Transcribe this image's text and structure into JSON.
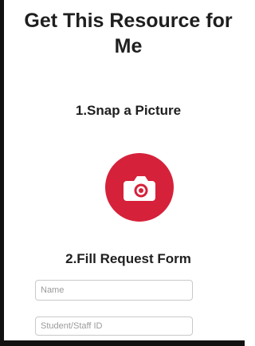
{
  "page": {
    "title": "Get This Resource for Me"
  },
  "steps": {
    "snap": "1.Snap a Picture",
    "form": "2.Fill Request Form"
  },
  "camera_button": {
    "icon": "camera-icon",
    "color": "#d6213a"
  },
  "form": {
    "name_placeholder": "Name",
    "name_value": "",
    "id_placeholder": "Student/Staff ID",
    "id_value": ""
  }
}
